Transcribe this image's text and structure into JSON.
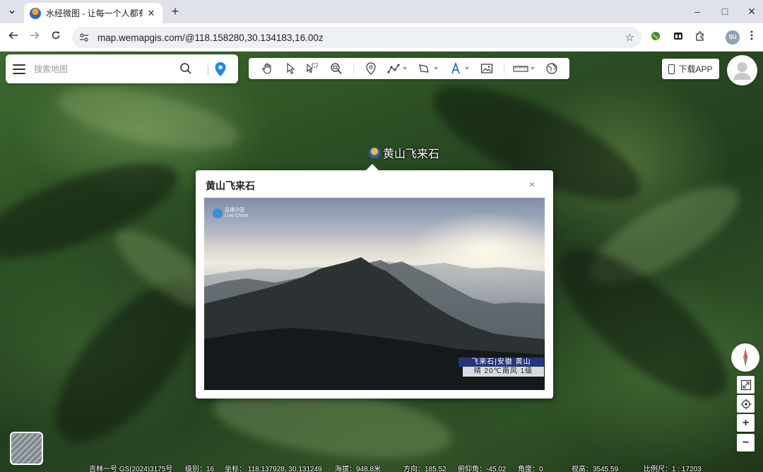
{
  "browser": {
    "tab_title": "水经微图 - 让每一个人都有自己",
    "url": "map.wemapgis.com/@118.158280,30.134183,16.00z",
    "profile_initials": "SU",
    "window_controls": {
      "minimize": "–",
      "maximize": "□",
      "close": "✕"
    }
  },
  "map": {
    "search": {
      "placeholder": "搜索地图"
    },
    "download_label": "下载APP",
    "poi_label": "黄山飞来石",
    "popup": {
      "title": "黄山飞来石",
      "close": "×",
      "photo": {
        "brand": "直播中国",
        "brand_sub": "Live China",
        "caption_top": "飞来石|安徽 黄山",
        "caption_bottom": "晴 20℃南风 1级"
      }
    },
    "controls": {
      "zoom_in": "+",
      "zoom_out": "−"
    },
    "status": {
      "source": "吉林一号 GS(2024)3175号",
      "level": "级别：16",
      "coords": "坐标：    118.137928, 30.131249",
      "altitude": "海拔：948.8米",
      "heading": "方向：185.52",
      "pitch": "俯仰角：-45.02",
      "angle": "角度：0",
      "view_height": "视高：3545.59",
      "scale": "比例尺：1 : 17203"
    }
  }
}
